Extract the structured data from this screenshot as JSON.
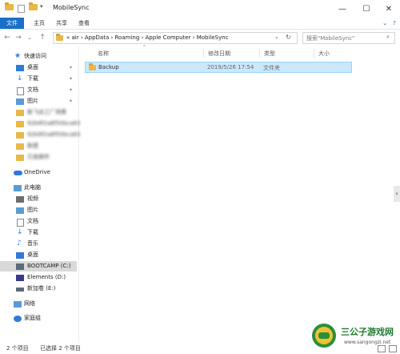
{
  "window": {
    "title": "MobileSync"
  },
  "ribbon": {
    "tabs": [
      "文件",
      "主页",
      "共享",
      "查看"
    ]
  },
  "address": {
    "crumbs": "«  air  ›  AppData  ›  Roaming  ›  Apple Computer  ›  MobileSync",
    "search_placeholder": "搜索\"MobileSync\""
  },
  "sidebar": {
    "quick_access": "快速访问",
    "quick_items": [
      "桌面",
      "下载",
      "文档",
      "图片"
    ],
    "blurred_items": [
      "新飞达工厂场景",
      "92b9f2a8f50bca83",
      "92b9f2a8f50bca83",
      "新建",
      "已发邮件"
    ],
    "onedrive": "OneDrive",
    "this_pc": "此电脑",
    "pc_items": [
      "视频",
      "图片",
      "文档",
      "下载",
      "音乐",
      "桌面"
    ],
    "drives": [
      "BOOTCAMP (C:)",
      "Elements (D:)",
      "新加卷 (E:)"
    ],
    "network": "网络",
    "homegroup": "家庭组"
  },
  "columns": {
    "name": "名称",
    "modified": "修改日期",
    "type": "类型",
    "size": "大小"
  },
  "files": [
    {
      "name": "Backup",
      "modified": "2019/5/26 17:54",
      "type": "文件夹",
      "size": ""
    }
  ],
  "status": {
    "count": "2 个项目",
    "selected": "已选择 2 个项目"
  },
  "watermark": {
    "brand": "三公子游戏网",
    "url": "www.sangongzi.net"
  },
  "colors": {
    "accent": "#1a6fc6",
    "selection": "#cce8ff",
    "folder": "#e8b84a"
  }
}
